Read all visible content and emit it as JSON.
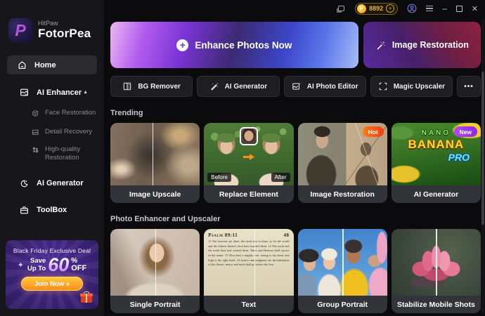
{
  "brand": {
    "top": "HitPaw",
    "name": "FotorPea"
  },
  "titlebar": {
    "credits": "8892",
    "coin_letter": "P",
    "add": "+",
    "minimize": "–",
    "close": "✕"
  },
  "sidebar": {
    "home": "Home",
    "nav_enhancer": "AI Enhancer",
    "caret": "▲",
    "sub": [
      {
        "label": "Face Restoration"
      },
      {
        "label": "Detail Recovery"
      },
      {
        "label": "High-quality Restoration"
      }
    ],
    "nav_generator": "AI Generator",
    "nav_toolbox": "ToolBox",
    "promo": {
      "title": "Black Friday Exclusive Deal",
      "sparkle": "✦",
      "save1": "Save",
      "save2": "Up To",
      "percent": "60",
      "psign": "%",
      "off": "OFF",
      "cta": "Join Now »"
    }
  },
  "hero": {
    "plus": "+",
    "enhance": "Enhance Photos Now",
    "restoration": "Image Restoration"
  },
  "tools": {
    "items": [
      {
        "label": "BG Remover"
      },
      {
        "label": "AI Generator"
      },
      {
        "label": "AI Photo Editor"
      },
      {
        "label": "Magic Upscaler"
      }
    ],
    "more": "•••"
  },
  "trending": {
    "title": "Trending",
    "cards": [
      {
        "label": "Image Upscale"
      },
      {
        "label": "Replace Element",
        "before": "Before",
        "after": "After"
      },
      {
        "label": "Image Restoration",
        "badge": "Hot"
      },
      {
        "label": "AI Generator",
        "badge": "New",
        "art_line1": "NANO",
        "art_line2": "BANANA",
        "art_line3": "PRO"
      }
    ]
  },
  "enhancer_section": {
    "title": "Photo Enhancer and Upscaler",
    "cards": [
      {
        "label": "Single Portrait"
      },
      {
        "label": "Text",
        "page_heading": "Psalm 89:11",
        "page_no": "48",
        "page_body": "11 The heavens are thine, the earth also is thine: as for the world and the fulness thereof, thou hast founded them. 12 The north and the south thou hast created them: Tabor and Hermon shall rejoice in thy name. 13 Thou hast a mighty arm: strong is thy hand, and high is thy right hand. 14 Justice and judgment are the habitation of thy throne: mercy and truth shall go before thy face."
      },
      {
        "label": "Group Portrait"
      },
      {
        "label": "Stabilize Mobile Shots"
      }
    ]
  },
  "colors": {
    "accent_purple": "#8a3ae0",
    "accent_blue": "#4a5ae8",
    "hot_badge": "#f84c10",
    "new_badge": "#a038e8",
    "gold": "#e8b33c",
    "promo_bg": "#3c2278",
    "cta_orange": "#ff8a1a",
    "sidebar_bg": "#17171b",
    "main_bg": "#0b0b0d",
    "card_bar": "#33333a"
  }
}
